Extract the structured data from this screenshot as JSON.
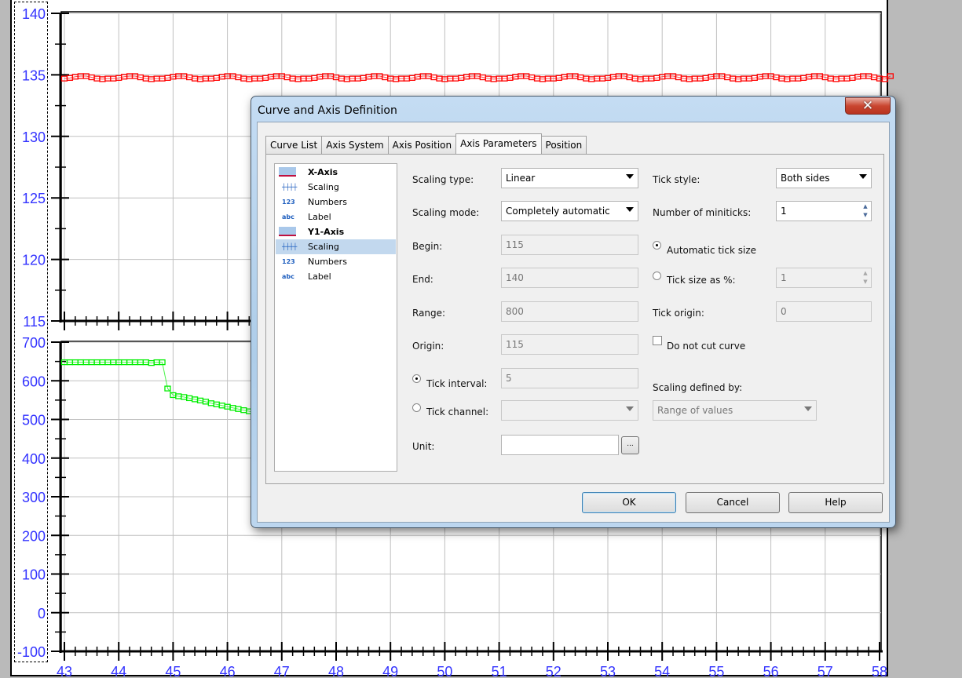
{
  "chart_data": [
    {
      "type": "line",
      "x_ticks": [
        "43",
        "44",
        "45",
        "46",
        "47",
        "48",
        "49",
        "50",
        "51",
        "52",
        "53",
        "54",
        "55",
        "56",
        "57",
        "58"
      ],
      "y_ticks": [
        "140",
        "135",
        "130",
        "125",
        "120",
        "115"
      ],
      "ylim": [
        115,
        140
      ],
      "xlim": [
        43,
        58
      ],
      "grid": true,
      "color": "#ff0000",
      "marker": "square",
      "x_start": 43,
      "x_step": 0.1,
      "values": [
        134.7,
        134.75,
        134.85,
        134.9,
        134.9,
        134.8,
        134.7,
        134.65,
        134.7,
        134.7,
        134.75,
        134.85,
        134.9,
        134.9,
        134.8,
        134.7,
        134.65,
        134.7,
        134.7,
        134.75,
        134.85,
        134.9,
        134.9,
        134.8,
        134.7,
        134.65,
        134.7,
        134.7,
        134.75,
        134.85,
        134.9,
        134.9,
        134.8,
        134.7,
        134.65,
        134.7,
        134.7,
        134.75,
        134.85,
        134.9,
        134.9,
        134.8,
        134.7,
        134.65,
        134.7,
        134.7,
        134.75,
        134.85,
        134.9,
        134.9,
        134.8,
        134.7,
        134.65,
        134.7,
        134.7,
        134.75,
        134.85,
        134.9,
        134.9,
        134.8,
        134.7,
        134.65,
        134.7,
        134.7,
        134.75,
        134.85,
        134.9,
        134.9,
        134.8,
        134.7,
        134.65,
        134.7,
        134.7,
        134.75,
        134.85,
        134.9,
        134.9,
        134.8,
        134.7,
        134.65,
        134.7,
        134.7,
        134.75,
        134.85,
        134.9,
        134.9,
        134.8,
        134.7,
        134.65,
        134.7,
        134.7,
        134.75,
        134.85,
        134.9,
        134.9,
        134.8,
        134.7,
        134.65,
        134.7,
        134.7,
        134.75,
        134.85,
        134.9,
        134.9,
        134.8,
        134.7,
        134.65,
        134.7,
        134.7,
        134.75,
        134.85,
        134.9,
        134.9,
        134.8,
        134.7,
        134.65,
        134.7,
        134.7,
        134.75,
        134.85,
        134.9,
        134.9,
        134.8,
        134.7,
        134.65,
        134.7,
        134.7,
        134.75,
        134.85,
        134.9,
        134.9,
        134.8,
        134.7,
        134.65,
        134.7,
        134.7,
        134.75,
        134.85,
        134.9,
        134.9,
        134.8,
        134.7,
        134.65,
        134.7,
        134.7,
        134.75,
        134.85,
        134.9,
        134.9,
        134.8,
        134.7,
        134.65,
        134.9
      ]
    },
    {
      "type": "line",
      "x_ticks": [
        "43",
        "44",
        "45",
        "46",
        "47",
        "48",
        "49",
        "50",
        "51",
        "52",
        "53",
        "54",
        "55",
        "56",
        "57",
        "58"
      ],
      "y_ticks": [
        "700",
        "600",
        "500",
        "400",
        "300",
        "200",
        "100",
        "0",
        "-100"
      ],
      "ylim": [
        -100,
        700
      ],
      "xlim": [
        43,
        58
      ],
      "grid": true,
      "color": "#00ee00",
      "marker": "square",
      "x_start": 43,
      "x_step": 0.1,
      "values": [
        648,
        648,
        648,
        648,
        648,
        648,
        648,
        648,
        648,
        648,
        648,
        648,
        648,
        648,
        648,
        648,
        646,
        648,
        648,
        580,
        563,
        560,
        558,
        555,
        552,
        549,
        546,
        542,
        539,
        536,
        533,
        530,
        527,
        524,
        521,
        518
      ]
    }
  ],
  "dialog": {
    "title": "Curve and Axis Definition",
    "close": "✕",
    "tabs": [
      "Curve List",
      "Axis System",
      "Axis Position",
      "Axis Parameters",
      "Position"
    ],
    "tree": [
      {
        "label": "X-Axis",
        "icon": "",
        "bold": true
      },
      {
        "label": "Scaling",
        "icon": "┼┼┼┼"
      },
      {
        "label": "Numbers",
        "icon": "123"
      },
      {
        "label": "Label",
        "icon": "abc"
      },
      {
        "label": "Y1-Axis",
        "icon": "",
        "bold": true
      },
      {
        "label": "Scaling",
        "icon": "┼┼┼┼"
      },
      {
        "label": "Numbers",
        "icon": "123"
      },
      {
        "label": "Label",
        "icon": "abc"
      }
    ],
    "scaling_type": {
      "label": "Scaling type:",
      "value": "Linear"
    },
    "scaling_mode": {
      "label": "Scaling mode:",
      "value": "Completely automatic"
    },
    "begin": {
      "label": "Begin:",
      "value": "115"
    },
    "end": {
      "label": "End:",
      "value": "140"
    },
    "range": {
      "label": "Range:",
      "value": "800"
    },
    "origin": {
      "label": "Origin:",
      "value": "115"
    },
    "tick_interval": {
      "label": "Tick interval:",
      "value": "5"
    },
    "tick_channel": {
      "label": "Tick channel:",
      "value": ""
    },
    "unit": {
      "label": "Unit:",
      "value": "",
      "browse": "..."
    },
    "tick_style": {
      "label": "Tick style:",
      "value": "Both sides"
    },
    "miniticks": {
      "label": "Number of miniticks:",
      "value": "1"
    },
    "auto_tick": {
      "label": "Automatic tick size"
    },
    "tick_pct": {
      "label": "Tick size as %:",
      "value": "1"
    },
    "tick_origin": {
      "label": "Tick origin:",
      "value": "0"
    },
    "no_cut": {
      "label": "Do not cut curve"
    },
    "scaling_by": {
      "label": "Scaling defined by:",
      "value": "Range of values"
    },
    "ok": "OK",
    "cancel": "Cancel",
    "help": "Help"
  }
}
